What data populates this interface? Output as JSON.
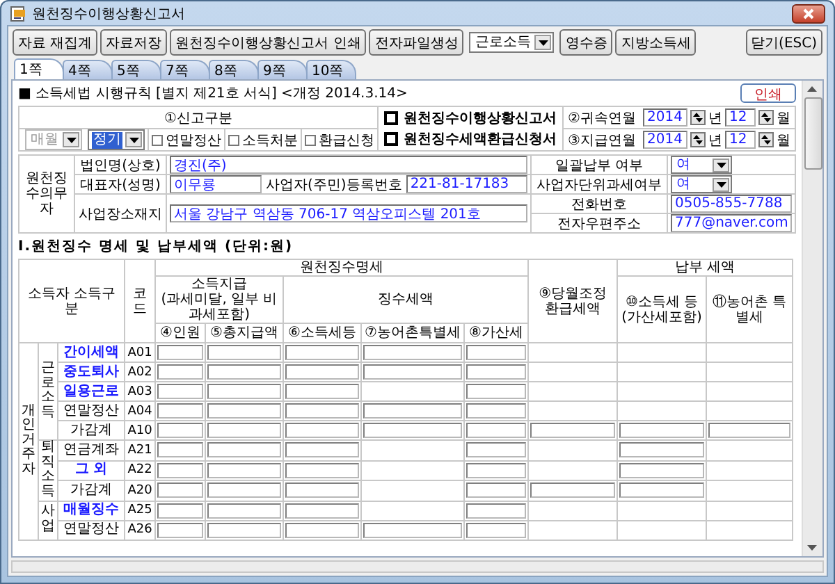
{
  "window": {
    "title": "원천징수이행상황신고서"
  },
  "toolbar": {
    "buttons": [
      "자료 재집계",
      "자료저장",
      "원천징수이행상황신고서 인쇄",
      "전자파일생성"
    ],
    "income_select": {
      "value": "근로소득"
    },
    "extra_buttons": [
      "영수증",
      "지방소득세"
    ],
    "close_button": "닫기(ESC)"
  },
  "tabs": [
    {
      "label": "1쪽",
      "selected": true
    },
    {
      "label": "4쪽",
      "selected": false
    },
    {
      "label": "5쪽",
      "selected": false
    },
    {
      "label": "7쪽",
      "selected": false
    },
    {
      "label": "8쪽",
      "selected": false
    },
    {
      "label": "9쪽",
      "selected": false
    },
    {
      "label": "10쪽",
      "selected": false
    }
  ],
  "form": {
    "header": "■ 소득세법 시행규칙 [별지 제21호 서식] <개정 2014.3.14>",
    "print_button": "인쇄",
    "report_type": {
      "label": "①신고구분",
      "period_select": {
        "value": "매월",
        "disabled": true
      },
      "type_select": {
        "value": "정기",
        "disabled": false,
        "focused": true
      },
      "options": [
        {
          "label": "연말정산",
          "checked": false
        },
        {
          "label": "소득처분",
          "checked": false
        },
        {
          "label": "환급신청",
          "checked": false
        }
      ]
    },
    "titles": [
      {
        "label": "원천징수이행상황신고서",
        "checked": false
      },
      {
        "label": "원천징수세액환급신청서",
        "checked": false
      }
    ],
    "dates": [
      {
        "label": "②귀속연월",
        "year": "2014",
        "year_unit": "년",
        "month": "12",
        "month_unit": "월"
      },
      {
        "label": "③지급연월",
        "year": "2014",
        "year_unit": "년",
        "month": "12",
        "month_unit": "월"
      }
    ],
    "agent": {
      "label": "원천징수의무자",
      "name": {
        "label": "법인명(상호)",
        "value": "경진(주)"
      },
      "representative": {
        "label": "대표자(성명)",
        "value": "이무룡"
      },
      "reg_no": {
        "label": "사업자(주민)등록번호",
        "value": "221-81-17183"
      },
      "address": {
        "label": "사업장소재지",
        "value": "서울 강남구 역삼동 706-17 역삼오피스텔 201호"
      },
      "bulk_payment": {
        "label": "일괄납부 여부",
        "value": "여"
      },
      "unit_tax": {
        "label": "사업자단위과세여부",
        "value": "여"
      },
      "phone": {
        "label": "전화번호",
        "value": "0505-855-7788"
      },
      "email": {
        "label": "전자우편주소",
        "value": "777@naver.com"
      }
    }
  },
  "section_title": "Ⅰ.원천징수 명세 및 납부세액 (단위:원)",
  "table": {
    "headers": {
      "income_type": "소득자 소득구분",
      "code": "코드",
      "withholding": "원천징수명세",
      "payment": "소득지급",
      "payment_note": "(과세미달, 일부 비과세포함)",
      "collected": "징수세액",
      "col_4": "④인원",
      "col_5": "⑤총지급액",
      "col_6": "⑥소득세등",
      "col_7": "⑦농어촌특별세",
      "col_8": "⑧가산세",
      "col_9": "⑨당월조정 환급세액",
      "due": "납부 세액",
      "col_10": "⑩소득세 등 (가산세포함)",
      "col_11": "⑪농어촌 특별세"
    },
    "groups": [
      {
        "label": "개인 거주자",
        "children": [
          {
            "label": "근로소득",
            "children": [
              {
                "name": "간이세액",
                "linked": true,
                "code": "A01",
                "inputs": [
                  true,
                  true,
                  true,
                  true,
                  true,
                  false,
                  false,
                  false
                ]
              },
              {
                "name": "중도퇴사",
                "linked": true,
                "code": "A02",
                "inputs": [
                  true,
                  true,
                  true,
                  true,
                  true,
                  false,
                  false,
                  false
                ]
              },
              {
                "name": "일용근로",
                "linked": true,
                "code": "A03",
                "inputs": [
                  true,
                  true,
                  true,
                  false,
                  true,
                  false,
                  false,
                  false
                ]
              },
              {
                "name": "연말정산",
                "linked": false,
                "code": "A04",
                "inputs": [
                  true,
                  true,
                  true,
                  true,
                  true,
                  false,
                  false,
                  false
                ]
              },
              {
                "name": "가감계",
                "linked": false,
                "code": "A10",
                "inputs": [
                  true,
                  true,
                  true,
                  true,
                  true,
                  true,
                  true,
                  true
                ]
              }
            ]
          },
          {
            "label": "퇴직소득",
            "children": [
              {
                "name": "연금계좌",
                "linked": false,
                "code": "A21",
                "inputs": [
                  true,
                  true,
                  true,
                  false,
                  true,
                  false,
                  true,
                  false
                ]
              },
              {
                "name": "그 외",
                "linked": true,
                "code": "A22",
                "inputs": [
                  true,
                  true,
                  true,
                  false,
                  true,
                  false,
                  true,
                  false
                ]
              },
              {
                "name": "가감계",
                "linked": false,
                "code": "A20",
                "inputs": [
                  true,
                  true,
                  true,
                  false,
                  true,
                  true,
                  true,
                  false
                ]
              }
            ]
          },
          {
            "label": "사업",
            "children": [
              {
                "name": "매월징수",
                "linked": true,
                "code": "A25",
                "inputs": [
                  true,
                  true,
                  true,
                  false,
                  true,
                  false,
                  false,
                  false
                ]
              },
              {
                "name": "연말정산",
                "linked": false,
                "code": "A26",
                "inputs": [
                  true,
                  true,
                  true,
                  true,
                  true,
                  false,
                  false,
                  false
                ]
              }
            ]
          }
        ]
      }
    ]
  }
}
